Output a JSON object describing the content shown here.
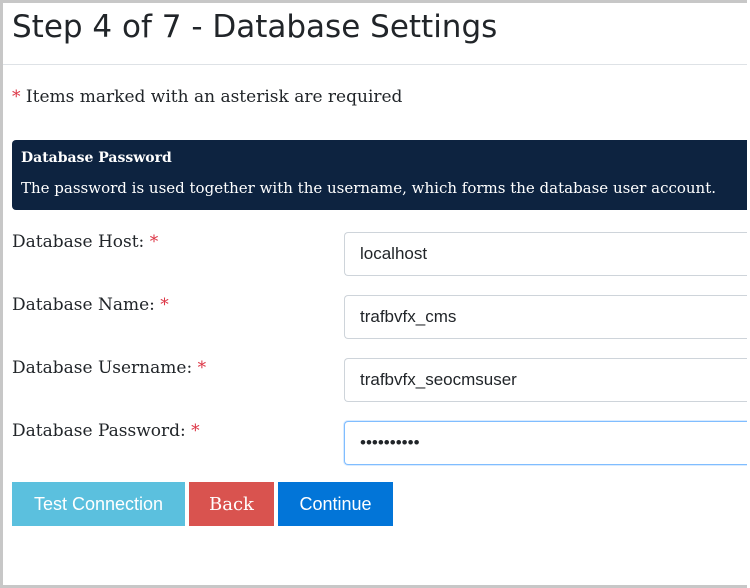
{
  "page": {
    "title": "Step 4 of 7 - Database Settings",
    "required_asterisk": "*",
    "required_note": " Items marked with an asterisk are required"
  },
  "info_panel": {
    "heading": "Database Password",
    "text": "The password is used together with the username, which forms the database user account."
  },
  "form": {
    "fields": [
      {
        "label": "Database Host:",
        "asterisk": "*",
        "value": "localhost",
        "type": "text"
      },
      {
        "label": "Database Name:",
        "asterisk": "*",
        "value": "trafbvfx_cms",
        "type": "text"
      },
      {
        "label": "Database Username:",
        "asterisk": "*",
        "value": "trafbvfx_seocmsuser",
        "type": "text"
      },
      {
        "label": "Database Password:",
        "asterisk": "*",
        "value": "1234567890",
        "type": "password"
      }
    ]
  },
  "buttons": {
    "test_connection": "Test Connection",
    "back": "Back",
    "continue": "Continue"
  },
  "colors": {
    "panel_bg": "#0d2340",
    "required": "#dc3545",
    "test_button": "#5bc0de",
    "back_button": "#d9534f",
    "continue_button": "#0275d8"
  }
}
